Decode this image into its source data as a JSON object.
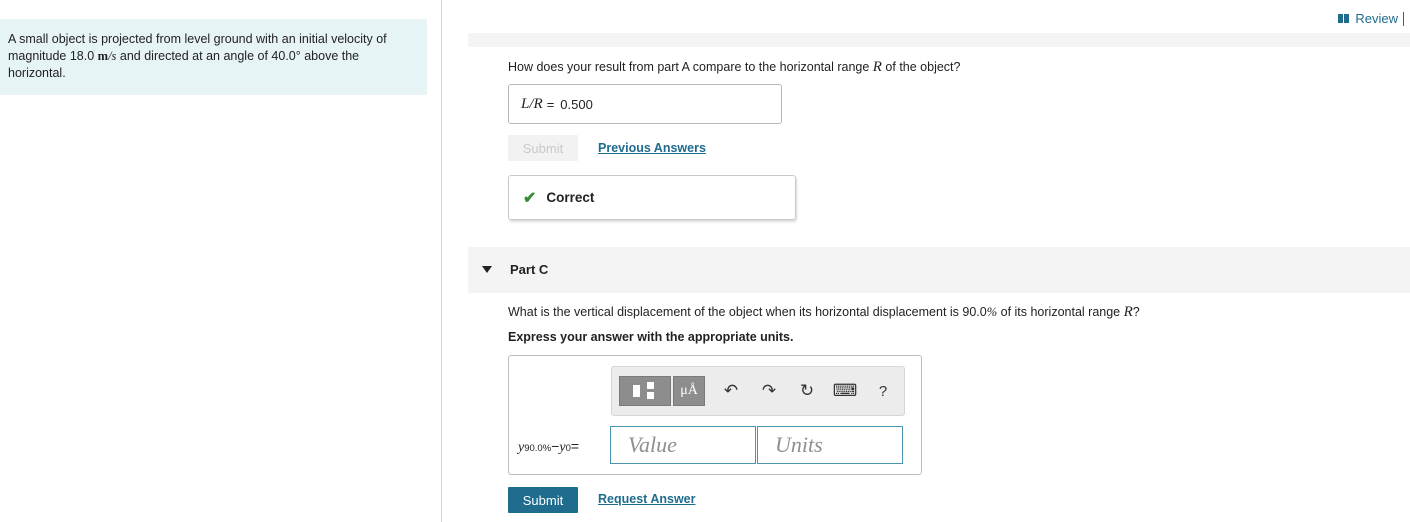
{
  "header": {
    "review_label": "Review"
  },
  "problem": {
    "text_1": "A small object is projected from level ground with an initial velocity of",
    "text_2a": "magnitude 18.0 ",
    "unit_m": "m",
    "unit_s": "/s",
    "text_2b": " and directed at an angle of 40.0",
    "degree": "°",
    "text_2c": " above the",
    "text_3": "horizontal."
  },
  "part_b": {
    "question_pre": "How does your result from part A compare to the horizontal range ",
    "question_var": "R",
    "question_post": " of the object?",
    "answer_label": "L/R",
    "answer_eq": "=",
    "answer_value": "0.500",
    "submit_label": "Submit",
    "previous_answers": "Previous Answers",
    "feedback": "Correct"
  },
  "part_c": {
    "title": "Part C",
    "question_pre": "What is the vertical displacement of the object when its horizontal displacement is 90.0",
    "question_pct": "%",
    "question_mid": " of its horizontal range ",
    "question_var": "R",
    "question_post": "?",
    "instruction": "Express your answer with the appropriate units.",
    "expr_y1": "y",
    "expr_sub1": "90.0%",
    "expr_minus": " − ",
    "expr_y2": "y",
    "expr_sub2": "0",
    "expr_eq": " =",
    "value_placeholder": "Value",
    "units_placeholder": "Units",
    "toolbar": {
      "units_symbol": "μÅ",
      "undo_icon": "↶",
      "redo_icon": "↷",
      "reset_icon": "↻",
      "keyboard_icon": "⌨",
      "help_label": "?"
    },
    "submit_label": "Submit",
    "request_answer": "Request Answer"
  },
  "colors": {
    "accent": "#1f6c8f",
    "problem_bg": "#e7f4f6",
    "correct_check": "#3a8a3a"
  }
}
